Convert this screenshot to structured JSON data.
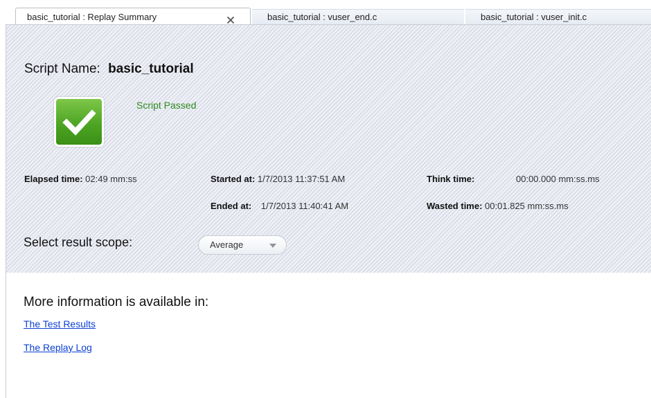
{
  "tabs": [
    {
      "label": "basic_tutorial : Replay Summary",
      "active": true,
      "closable": true
    },
    {
      "label": "basic_tutorial : vuser_end.c",
      "active": false
    },
    {
      "label": "basic_tutorial : vuser_init.c",
      "active": false
    }
  ],
  "summary": {
    "script_name_label": "Script Name:",
    "script_name_value": "basic_tutorial",
    "status": "Script Passed",
    "status_icon": "check-icon",
    "status_color": "#2e8b1e",
    "elapsed_label": "Elapsed time:",
    "elapsed_value": "02:49 mm:ss",
    "started_label": "Started at:",
    "started_value": "1/7/2013 11:37:51 AM",
    "ended_label": "Ended at:",
    "ended_value": "1/7/2013 11:40:41 AM",
    "think_label": "Think time:",
    "think_value": "00:00.000 mm:ss.ms",
    "wasted_label": "Wasted time:",
    "wasted_value": "00:01.825 mm:ss.ms",
    "scope_label": "Select result scope:",
    "scope_value": "Average"
  },
  "more_info": {
    "title": "More information is available in:",
    "links": [
      "The Test Results",
      "The Replay Log"
    ]
  },
  "colors": {
    "link": "#0b3fd6",
    "pass_green": "#4ea523"
  }
}
